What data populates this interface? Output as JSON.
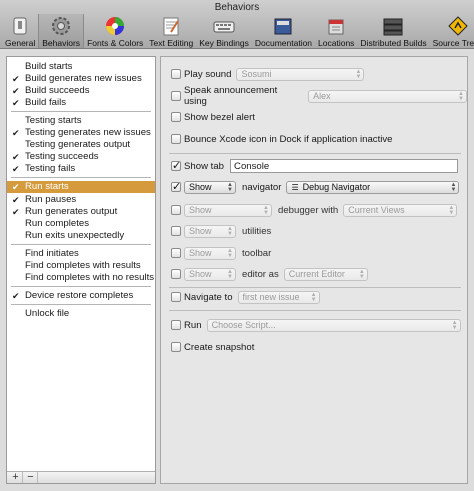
{
  "window": {
    "title": "Behaviors"
  },
  "toolbar": {
    "items": [
      {
        "label": "General",
        "icon": "switch-icon"
      },
      {
        "label": "Behaviors",
        "icon": "gear-icon",
        "selected": true
      },
      {
        "label": "Fonts & Colors",
        "icon": "color-wheel-icon"
      },
      {
        "label": "Text Editing",
        "icon": "text-document-icon"
      },
      {
        "label": "Key Bindings",
        "icon": "keyboard-icon"
      },
      {
        "label": "Documentation",
        "icon": "book-icon"
      },
      {
        "label": "Locations",
        "icon": "locations-icon"
      },
      {
        "label": "Distributed Builds",
        "icon": "server-icon"
      },
      {
        "label": "Source Trees",
        "icon": "warning-sign-icon"
      }
    ]
  },
  "events": {
    "build_starts": "Build starts",
    "build_generates_new_issues": "Build generates new issues",
    "build_succeeds": "Build succeeds",
    "build_fails": "Build fails",
    "testing_starts": "Testing starts",
    "testing_generates_new_issues": "Testing generates new issues",
    "testing_generates_output": "Testing generates output",
    "testing_succeeds": "Testing succeeds",
    "testing_fails": "Testing fails",
    "run_starts": "Run starts",
    "run_pauses": "Run pauses",
    "run_generates_output": "Run generates output",
    "run_completes": "Run completes",
    "run_exits_unexpectedly": "Run exits unexpectedly",
    "find_initiates": "Find initiates",
    "find_completes_with_results": "Find completes with results",
    "find_completes_with_no_results": "Find completes with no results",
    "device_restore_completes": "Device restore completes",
    "unlock_file": "Unlock file",
    "checked": "✔",
    "add": "+",
    "remove": "−"
  },
  "options": {
    "play_sound": "Play sound",
    "sound_value": "Sosumi",
    "speak_announcement": "Speak announcement using",
    "voice_value": "Alex",
    "show_bezel": "Show bezel alert",
    "bounce_icon": "Bounce Xcode icon in Dock if application inactive",
    "show_tab": "Show tab",
    "tab_value": "Console",
    "show_value": "Show",
    "navigator_label": "navigator",
    "navigator_value": "Debug Navigator",
    "debugger_with": "debugger with",
    "debugger_value": "Current Views",
    "utilities_label": "utilities",
    "toolbar_label": "toolbar",
    "editor_as": "editor as",
    "editor_value": "Current Editor",
    "navigate_to": "Navigate to",
    "navigate_value": "first new issue",
    "run_label": "Run",
    "run_value": "Choose Script...",
    "create_snapshot": "Create snapshot"
  }
}
